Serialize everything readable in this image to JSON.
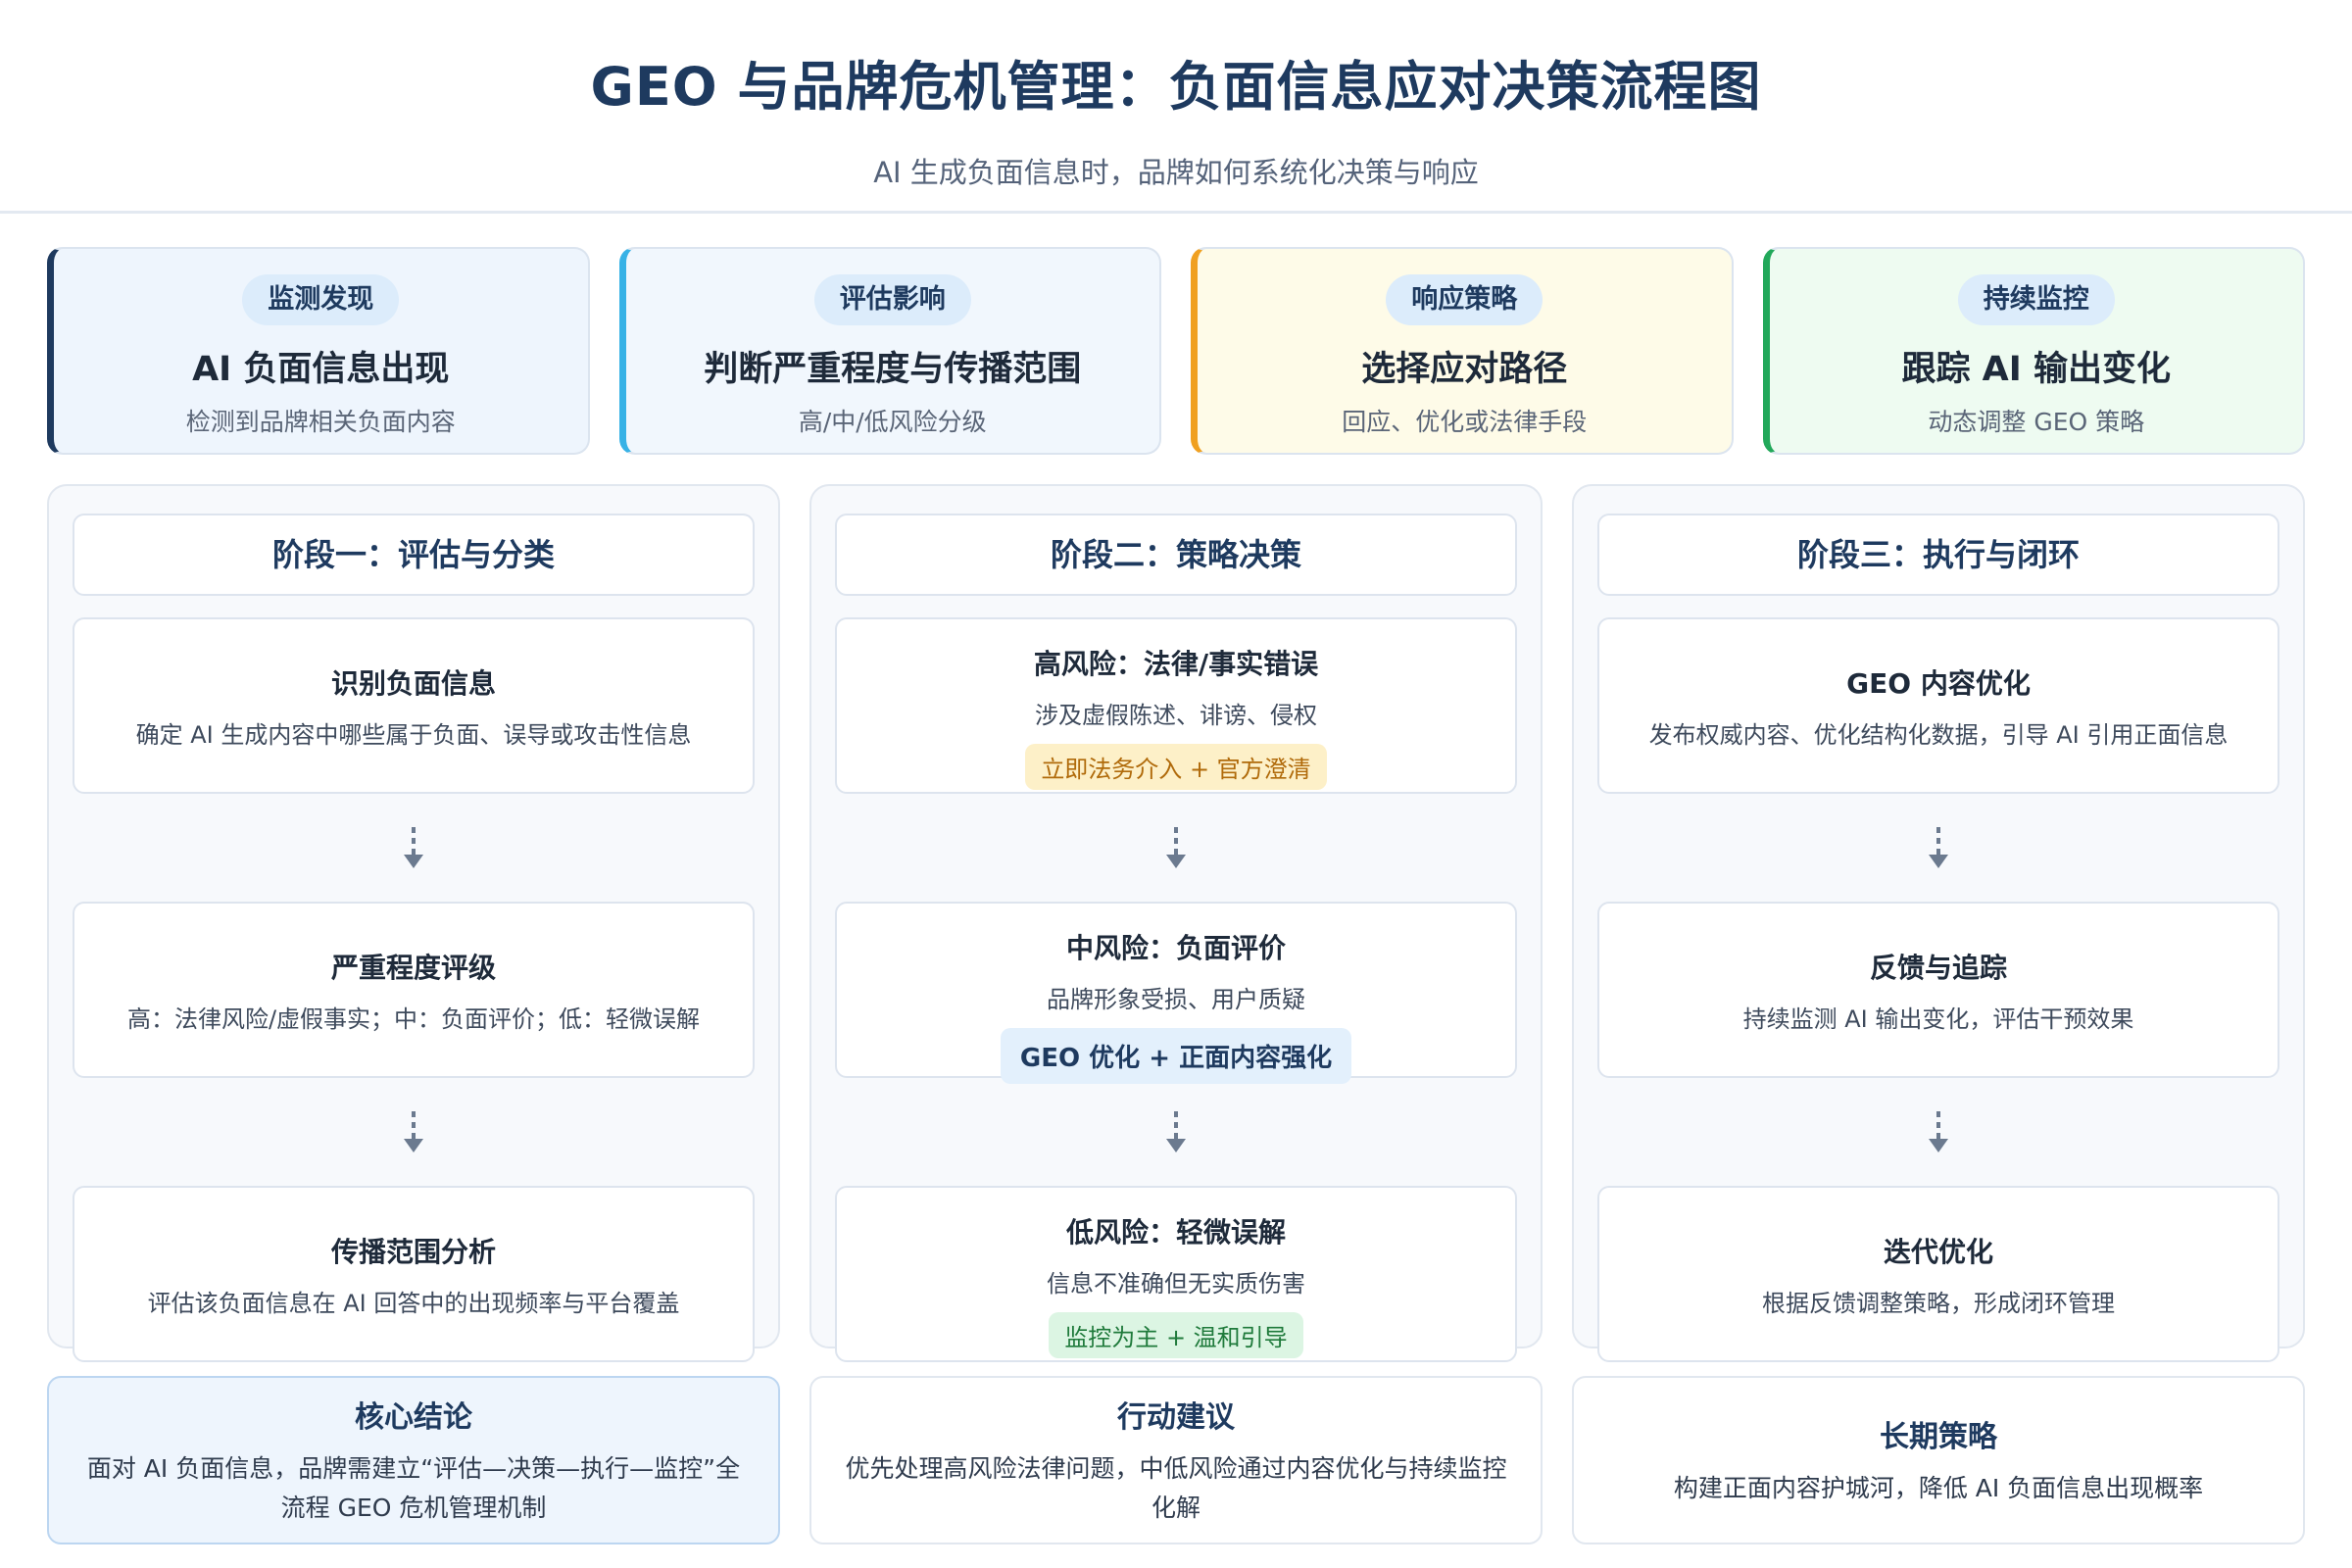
{
  "header": {
    "title": "GEO 与品牌危机管理：负面信息应对决策流程图",
    "subtitle": "AI 生成负面信息时，品牌如何系统化决策与响应"
  },
  "stages": [
    {
      "badge": "监测发现",
      "title": "AI 负面信息出现",
      "desc": "检测到品牌相关负面内容",
      "accent": "#1e3a5f",
      "bg": "#eef5fd",
      "badge_bg": "#dcecfb"
    },
    {
      "badge": "评估影响",
      "title": "判断严重程度与传播范围",
      "desc": "高/中/低风险分级",
      "accent": "#38b2e6",
      "bg": "#f1f7fd",
      "badge_bg": "#dcecfb"
    },
    {
      "badge": "响应策略",
      "title": "选择应对路径",
      "desc": "回应、优化或法律手段",
      "accent": "#f0a020",
      "bg": "#fefbe8",
      "badge_bg": "#dcecfb"
    },
    {
      "badge": "持续监控",
      "title": "跟踪 AI 输出变化",
      "desc": "动态调整 GEO 策略",
      "accent": "#22a85a",
      "bg": "#eefbf1",
      "badge_bg": "#dcecfb"
    }
  ],
  "phases": [
    {
      "head": "阶段一：评估与分类",
      "steps": [
        {
          "title": "识别负面信息",
          "desc": "确定 AI 生成内容中哪些属于负面、误导或攻击性信息"
        },
        {
          "title": "严重程度评级",
          "desc": "高：法律风险/虚假事实；中：负面评价；低：轻微误解"
        },
        {
          "title": "传播范围分析",
          "desc": "评估该负面信息在 AI 回答中的出现频率与平台覆盖"
        }
      ]
    },
    {
      "head": "阶段二：策略决策",
      "steps": [
        {
          "title": "高风险：法律/事实错误",
          "desc": "涉及虚假陈述、诽谤、侵权",
          "tag": "立即法务介入 + 官方澄清",
          "tag_type": "high"
        },
        {
          "title": "中风险：负面评价",
          "desc": "品牌形象受损、用户质疑",
          "tag": "GEO 优化 + 正面内容强化",
          "tag_type": "mid"
        },
        {
          "title": "低风险：轻微误解",
          "desc": "信息不准确但无实质伤害",
          "tag": "监控为主 + 温和引导",
          "tag_type": "low"
        }
      ]
    },
    {
      "head": "阶段三：执行与闭环",
      "steps": [
        {
          "title": "GEO 内容优化",
          "desc": "发布权威内容、优化结构化数据，引导 AI 引用正面信息"
        },
        {
          "title": "反馈与追踪",
          "desc": "持续监测 AI 输出变化，评估干预效果"
        },
        {
          "title": "迭代优化",
          "desc": "根据反馈调整策略，形成闭环管理"
        }
      ]
    }
  ],
  "summary": [
    {
      "title": "核心结论",
      "text": "面对 AI 负面信息，品牌需建立“评估—决策—执行—监控”全流程 GEO 危机管理机制"
    },
    {
      "title": "行动建议",
      "text": "优先处理高风险法律问题，中低风险通过内容优化与持续监控化解"
    },
    {
      "title": "长期策略",
      "text": "构建正面内容护城河，降低 AI 负面信息出现概率"
    }
  ]
}
